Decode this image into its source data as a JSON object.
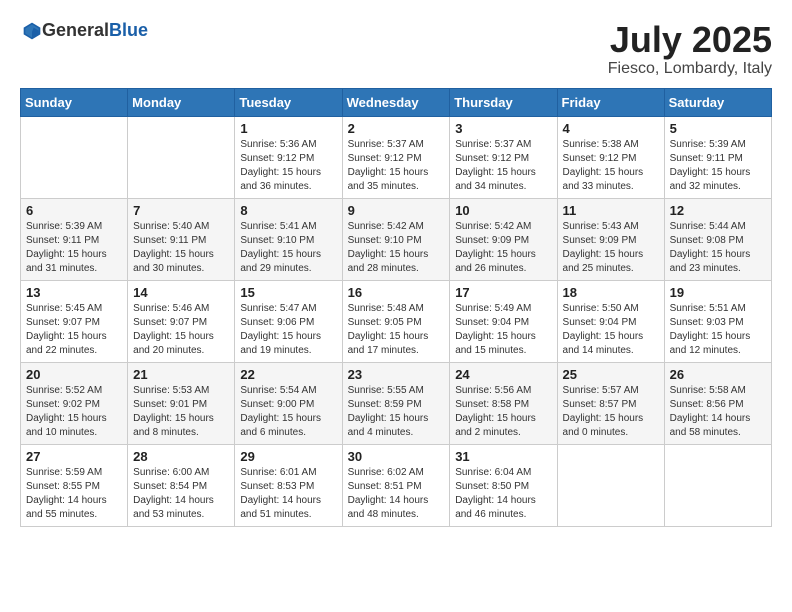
{
  "logo": {
    "general": "General",
    "blue": "Blue"
  },
  "header": {
    "month": "July 2025",
    "location": "Fiesco, Lombardy, Italy"
  },
  "weekdays": [
    "Sunday",
    "Monday",
    "Tuesday",
    "Wednesday",
    "Thursday",
    "Friday",
    "Saturday"
  ],
  "weeks": [
    [
      {
        "day": "",
        "info": ""
      },
      {
        "day": "",
        "info": ""
      },
      {
        "day": "1",
        "info": "Sunrise: 5:36 AM\nSunset: 9:12 PM\nDaylight: 15 hours and 36 minutes."
      },
      {
        "day": "2",
        "info": "Sunrise: 5:37 AM\nSunset: 9:12 PM\nDaylight: 15 hours and 35 minutes."
      },
      {
        "day": "3",
        "info": "Sunrise: 5:37 AM\nSunset: 9:12 PM\nDaylight: 15 hours and 34 minutes."
      },
      {
        "day": "4",
        "info": "Sunrise: 5:38 AM\nSunset: 9:12 PM\nDaylight: 15 hours and 33 minutes."
      },
      {
        "day": "5",
        "info": "Sunrise: 5:39 AM\nSunset: 9:11 PM\nDaylight: 15 hours and 32 minutes."
      }
    ],
    [
      {
        "day": "6",
        "info": "Sunrise: 5:39 AM\nSunset: 9:11 PM\nDaylight: 15 hours and 31 minutes."
      },
      {
        "day": "7",
        "info": "Sunrise: 5:40 AM\nSunset: 9:11 PM\nDaylight: 15 hours and 30 minutes."
      },
      {
        "day": "8",
        "info": "Sunrise: 5:41 AM\nSunset: 9:10 PM\nDaylight: 15 hours and 29 minutes."
      },
      {
        "day": "9",
        "info": "Sunrise: 5:42 AM\nSunset: 9:10 PM\nDaylight: 15 hours and 28 minutes."
      },
      {
        "day": "10",
        "info": "Sunrise: 5:42 AM\nSunset: 9:09 PM\nDaylight: 15 hours and 26 minutes."
      },
      {
        "day": "11",
        "info": "Sunrise: 5:43 AM\nSunset: 9:09 PM\nDaylight: 15 hours and 25 minutes."
      },
      {
        "day": "12",
        "info": "Sunrise: 5:44 AM\nSunset: 9:08 PM\nDaylight: 15 hours and 23 minutes."
      }
    ],
    [
      {
        "day": "13",
        "info": "Sunrise: 5:45 AM\nSunset: 9:07 PM\nDaylight: 15 hours and 22 minutes."
      },
      {
        "day": "14",
        "info": "Sunrise: 5:46 AM\nSunset: 9:07 PM\nDaylight: 15 hours and 20 minutes."
      },
      {
        "day": "15",
        "info": "Sunrise: 5:47 AM\nSunset: 9:06 PM\nDaylight: 15 hours and 19 minutes."
      },
      {
        "day": "16",
        "info": "Sunrise: 5:48 AM\nSunset: 9:05 PM\nDaylight: 15 hours and 17 minutes."
      },
      {
        "day": "17",
        "info": "Sunrise: 5:49 AM\nSunset: 9:04 PM\nDaylight: 15 hours and 15 minutes."
      },
      {
        "day": "18",
        "info": "Sunrise: 5:50 AM\nSunset: 9:04 PM\nDaylight: 15 hours and 14 minutes."
      },
      {
        "day": "19",
        "info": "Sunrise: 5:51 AM\nSunset: 9:03 PM\nDaylight: 15 hours and 12 minutes."
      }
    ],
    [
      {
        "day": "20",
        "info": "Sunrise: 5:52 AM\nSunset: 9:02 PM\nDaylight: 15 hours and 10 minutes."
      },
      {
        "day": "21",
        "info": "Sunrise: 5:53 AM\nSunset: 9:01 PM\nDaylight: 15 hours and 8 minutes."
      },
      {
        "day": "22",
        "info": "Sunrise: 5:54 AM\nSunset: 9:00 PM\nDaylight: 15 hours and 6 minutes."
      },
      {
        "day": "23",
        "info": "Sunrise: 5:55 AM\nSunset: 8:59 PM\nDaylight: 15 hours and 4 minutes."
      },
      {
        "day": "24",
        "info": "Sunrise: 5:56 AM\nSunset: 8:58 PM\nDaylight: 15 hours and 2 minutes."
      },
      {
        "day": "25",
        "info": "Sunrise: 5:57 AM\nSunset: 8:57 PM\nDaylight: 15 hours and 0 minutes."
      },
      {
        "day": "26",
        "info": "Sunrise: 5:58 AM\nSunset: 8:56 PM\nDaylight: 14 hours and 58 minutes."
      }
    ],
    [
      {
        "day": "27",
        "info": "Sunrise: 5:59 AM\nSunset: 8:55 PM\nDaylight: 14 hours and 55 minutes."
      },
      {
        "day": "28",
        "info": "Sunrise: 6:00 AM\nSunset: 8:54 PM\nDaylight: 14 hours and 53 minutes."
      },
      {
        "day": "29",
        "info": "Sunrise: 6:01 AM\nSunset: 8:53 PM\nDaylight: 14 hours and 51 minutes."
      },
      {
        "day": "30",
        "info": "Sunrise: 6:02 AM\nSunset: 8:51 PM\nDaylight: 14 hours and 48 minutes."
      },
      {
        "day": "31",
        "info": "Sunrise: 6:04 AM\nSunset: 8:50 PM\nDaylight: 14 hours and 46 minutes."
      },
      {
        "day": "",
        "info": ""
      },
      {
        "day": "",
        "info": ""
      }
    ]
  ]
}
